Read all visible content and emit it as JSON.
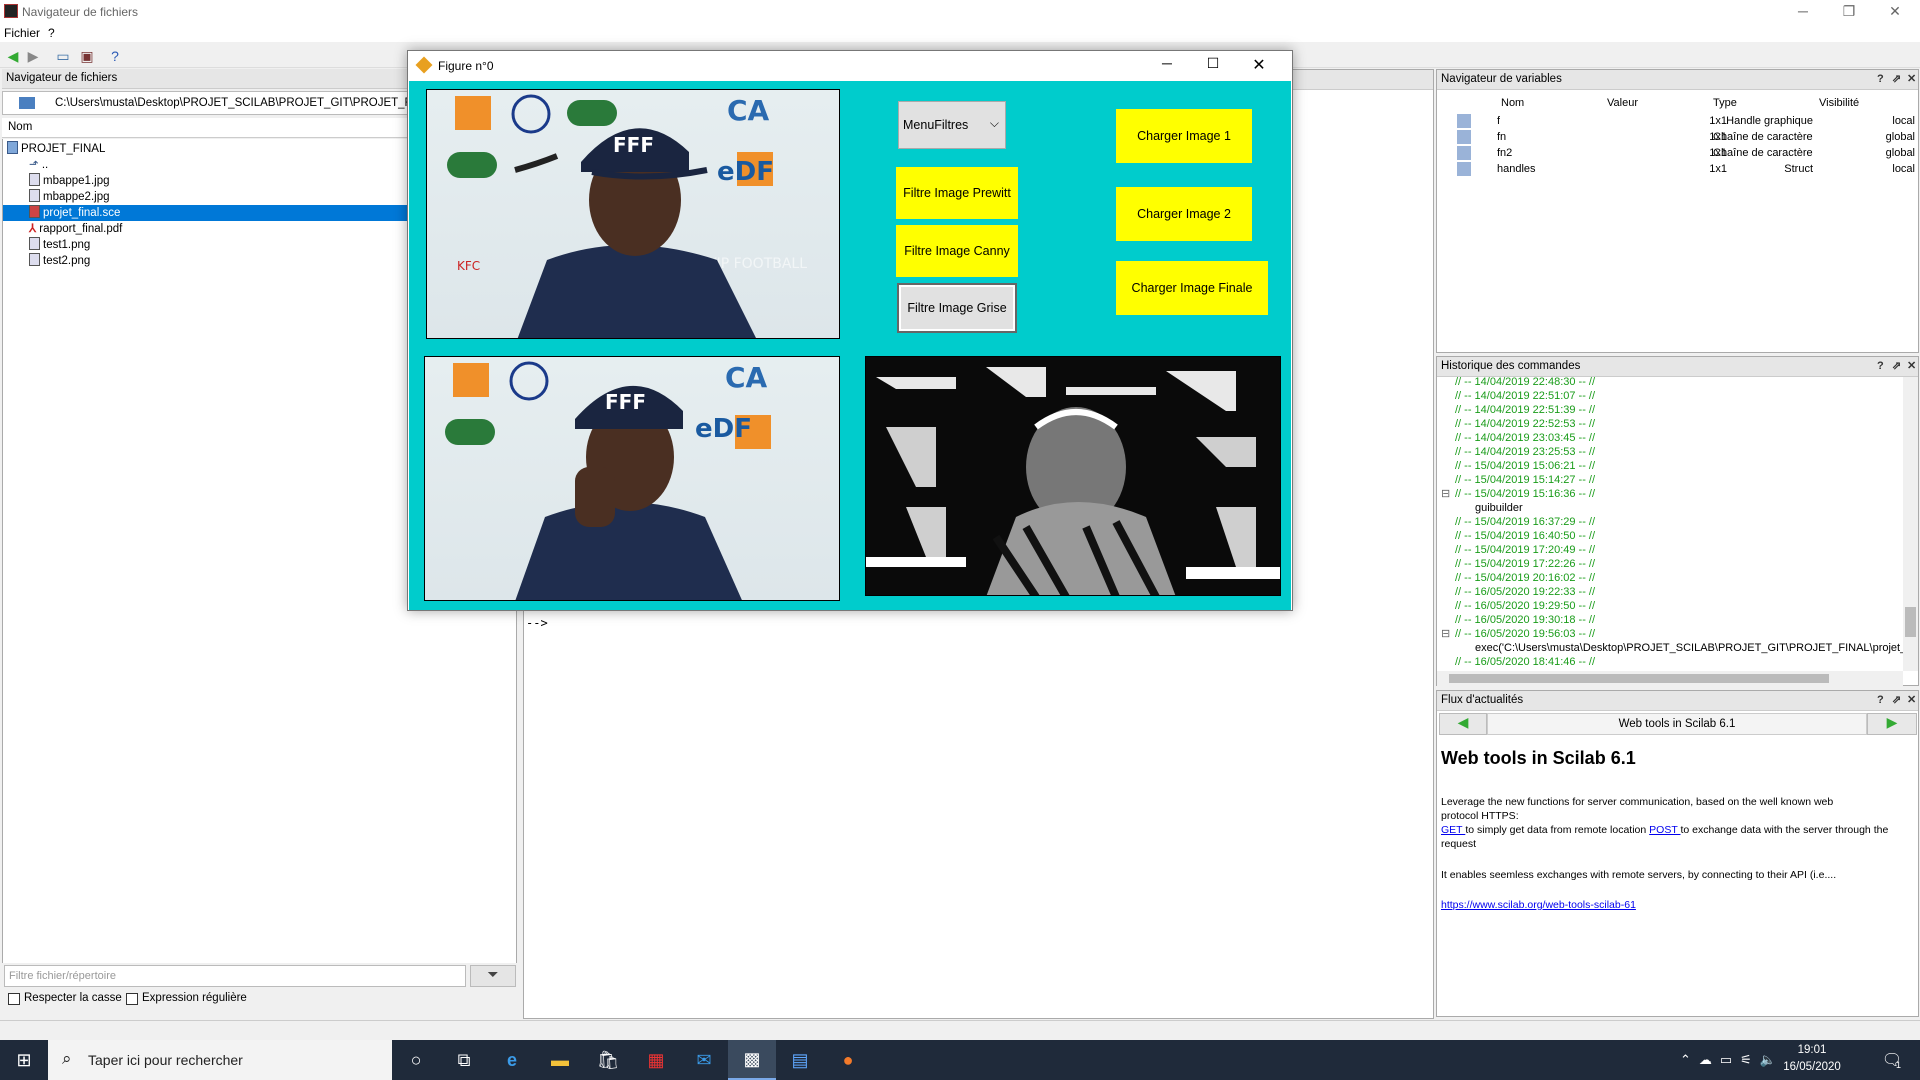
{
  "window": {
    "title": "Navigateur de fichiers"
  },
  "menu": {
    "items": [
      "Fichier",
      "?"
    ]
  },
  "file_browser": {
    "title": "Navigateur de fichiers",
    "path": "C:\\Users\\musta\\Desktop\\PROJET_SCILAB\\PROJET_GIT\\PROJET_FINAL\\",
    "column": "Nom",
    "root": "PROJET_FINAL",
    "parent": "..",
    "files": [
      "mbappe1.jpg",
      "mbappe2.jpg",
      "projet_final.sce",
      "rapport_final.pdf",
      "test1.png",
      "test2.png"
    ],
    "selected": "projet_final.sce",
    "filter_placeholder": "Filtre fichier/répertoire",
    "case_label": "Respecter la casse",
    "regex_label": "Expression régulière"
  },
  "console": {
    "prompt": "-->"
  },
  "figure": {
    "title": "Figure n°0",
    "dropdown": "MenuFiltres",
    "buttons": {
      "prewitt": "Filtre Image Prewitt",
      "canny": "Filtre Image Canny",
      "grise": "Filtre Image Grise",
      "load1": "Charger Image 1",
      "load2": "Charger Image 2",
      "loadfinal": "Charger Image Finale"
    },
    "sponsors": {
      "orange": "orange",
      "pmu": "PMU",
      "fff": "FFF",
      "ca": "CA",
      "edf": "eDF",
      "kfc": "KFC",
      "accor": "ACCOR HOTELS",
      "watermark": "VIP FOOTBALL"
    }
  },
  "variables": {
    "title": "Navigateur de variables",
    "headers": [
      "Nom",
      "Valeur",
      "Type",
      "Visibilité"
    ],
    "rows": [
      {
        "name": "f",
        "value": "1x1",
        "type": "Handle graphique",
        "vis": "local"
      },
      {
        "name": "fn",
        "value": "1x1",
        "type": "Chaîne de caractères",
        "vis": "global"
      },
      {
        "name": "fn2",
        "value": "1x1",
        "type": "Chaîne de caractères",
        "vis": "global"
      },
      {
        "name": "handles",
        "value": "1x1",
        "type": "Struct",
        "vis": "local"
      }
    ]
  },
  "history": {
    "title": "Historique des commandes",
    "entries": [
      "// -- 14/04/2019 22:48:30 -- //",
      "// -- 14/04/2019 22:51:07 -- //",
      "// -- 14/04/2019 22:51:39 -- //",
      "// -- 14/04/2019 22:52:53 -- //",
      "// -- 14/04/2019 23:03:45 -- //",
      "// -- 14/04/2019 23:25:53 -- //",
      "// -- 15/04/2019 15:06:21 -- //",
      "// -- 15/04/2019 15:14:27 -- //",
      "// -- 15/04/2019 15:16:36 -- //",
      "guibuilder",
      "// -- 15/04/2019 16:37:29 -- //",
      "// -- 15/04/2019 16:40:50 -- //",
      "// -- 15/04/2019 17:20:49 -- //",
      "// -- 15/04/2019 17:22:26 -- //",
      "// -- 15/04/2019 20:16:02 -- //",
      "// -- 16/05/2020 19:22:33 -- //",
      "// -- 16/05/2020 19:29:50 -- //",
      "// -- 16/05/2020 19:30:18 -- //",
      "// -- 16/05/2020 19:56:03 -- //",
      "exec('C:\\Users\\musta\\Desktop\\PROJET_SCILAB\\PROJET_GIT\\PROJET_FINAL\\projet_fina",
      "// -- 16/05/2020 18:41:46 -- //"
    ]
  },
  "news": {
    "title": "Flux d'actualités",
    "header": "Web tools in Scilab 6.1",
    "heading": "Web tools in Scilab 6.1",
    "para1": "Leverage the new functions for server communication, based on the well known web protocol HTTPS:",
    "get_link": "GET ",
    "get_text": "to simply get data from remote location ",
    "post_link": "POST ",
    "post_text": "to exchange data with the server through the request",
    "para2": "It enables seemless exchanges with remote servers, by connecting to their API (i.e....",
    "url": "https://www.scilab.org/web-tools-scilab-61"
  },
  "taskbar": {
    "search": "Taper ici pour rechercher",
    "time": "19:01",
    "date": "16/05/2020",
    "notif": "1"
  }
}
